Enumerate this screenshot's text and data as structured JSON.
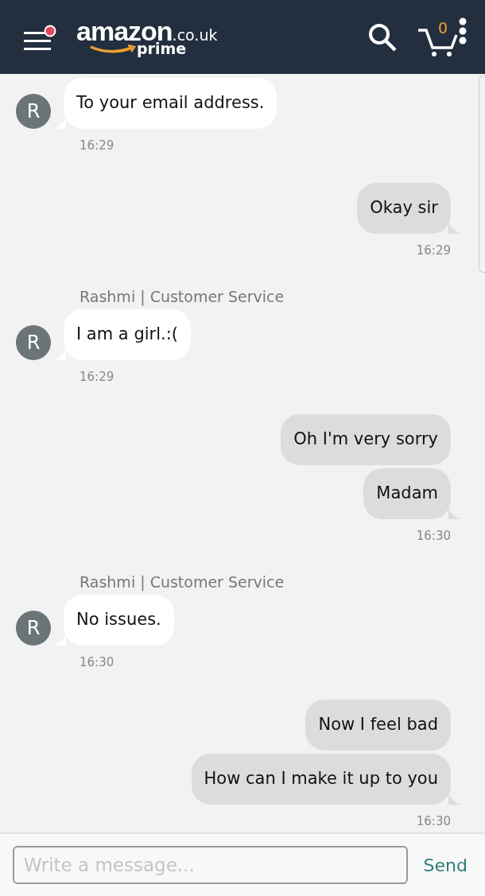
{
  "header": {
    "logo": {
      "brand": "amazon",
      "domain": ".co.uk",
      "tier": "prime"
    },
    "menu_notification": true,
    "cart_count": "0"
  },
  "messages": [
    {
      "kind": "agent",
      "avatar": "R",
      "bubbles": [
        "To your email address."
      ],
      "time": "16:29"
    },
    {
      "kind": "user",
      "bubbles": [
        "Okay sir"
      ],
      "time": "16:29"
    },
    {
      "kind": "agent",
      "name": "Rashmi | Customer Service",
      "avatar": "R",
      "bubbles": [
        "I am a girl.:("
      ],
      "time": "16:29"
    },
    {
      "kind": "user",
      "bubbles": [
        "Oh I'm very sorry",
        "Madam"
      ],
      "time": "16:30"
    },
    {
      "kind": "agent",
      "name": "Rashmi | Customer Service",
      "avatar": "R",
      "bubbles": [
        "No issues."
      ],
      "time": "16:30"
    },
    {
      "kind": "user",
      "bubbles": [
        "Now I feel bad",
        "How can I make it up to you"
      ],
      "time": "16:30"
    }
  ],
  "composer": {
    "placeholder": "Write a message...",
    "send_label": "Send"
  }
}
